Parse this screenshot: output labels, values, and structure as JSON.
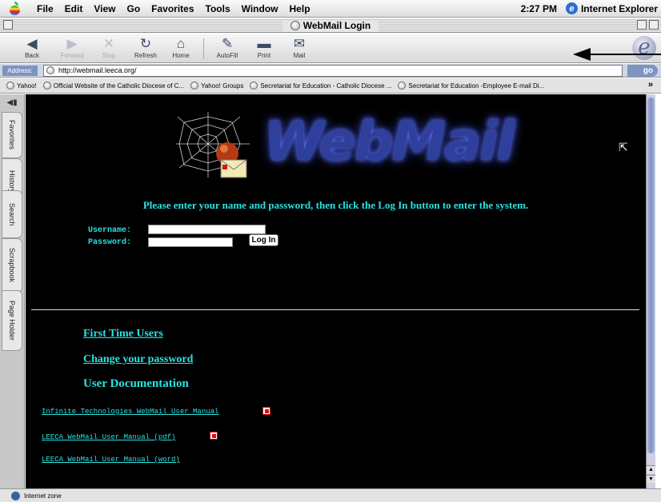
{
  "menubar": {
    "items": [
      "File",
      "Edit",
      "View",
      "Go",
      "Favorites",
      "Tools",
      "Window",
      "Help"
    ],
    "clock": "2:27 PM",
    "app_name": "Internet Explorer"
  },
  "window": {
    "title": "WebMail Login"
  },
  "toolbar": {
    "buttons": [
      {
        "label": "Back",
        "icon": "back-arrow-icon"
      },
      {
        "label": "Forward",
        "icon": "forward-arrow-icon"
      },
      {
        "label": "Stop",
        "icon": "stop-icon"
      },
      {
        "label": "Refresh",
        "icon": "refresh-icon"
      },
      {
        "label": "Home",
        "icon": "home-icon"
      },
      {
        "label": "AutoFill",
        "icon": "autofill-icon"
      },
      {
        "label": "Print",
        "icon": "printer-icon"
      },
      {
        "label": "Mail",
        "icon": "mail-icon"
      }
    ]
  },
  "address": {
    "label": "Address:",
    "url": "http://webmail.leeca.org/",
    "go_label": "go"
  },
  "favorites": {
    "items": [
      "Yahoo!",
      "Official Website of the Catholic Diocese of C...",
      "Yahoo! Groups",
      "Secretariat for Education - Catholic Diocese ...",
      "Secretariat for Education -Employee E-mail Di..."
    ],
    "more": "»"
  },
  "sidebar": {
    "tabs": [
      "Favorites",
      "History",
      "Search",
      "Scrapbook",
      "Page Holder"
    ]
  },
  "page": {
    "logo_text": "WebMail",
    "prompt": "Please enter your name and password, then click the Log In button to enter the system.",
    "username_label": "Username:",
    "password_label": "Password:",
    "username_value": "",
    "password_value": "",
    "login_label": "Log In",
    "links": {
      "first_time": "First Time Users",
      "change_password": "Change your password"
    },
    "docs_heading": "User Documentation",
    "docs": [
      "Infinite Technologies WebMail User Manual",
      "LEECA WebMail User Manual (pdf)",
      "LEECA WebMail User Manual (word)"
    ]
  },
  "status": {
    "zone": "Internet zone"
  },
  "colors": {
    "page_background": "#000000",
    "link_cyan": "#27e3e3",
    "logo_blue": "#2f3f9c"
  }
}
